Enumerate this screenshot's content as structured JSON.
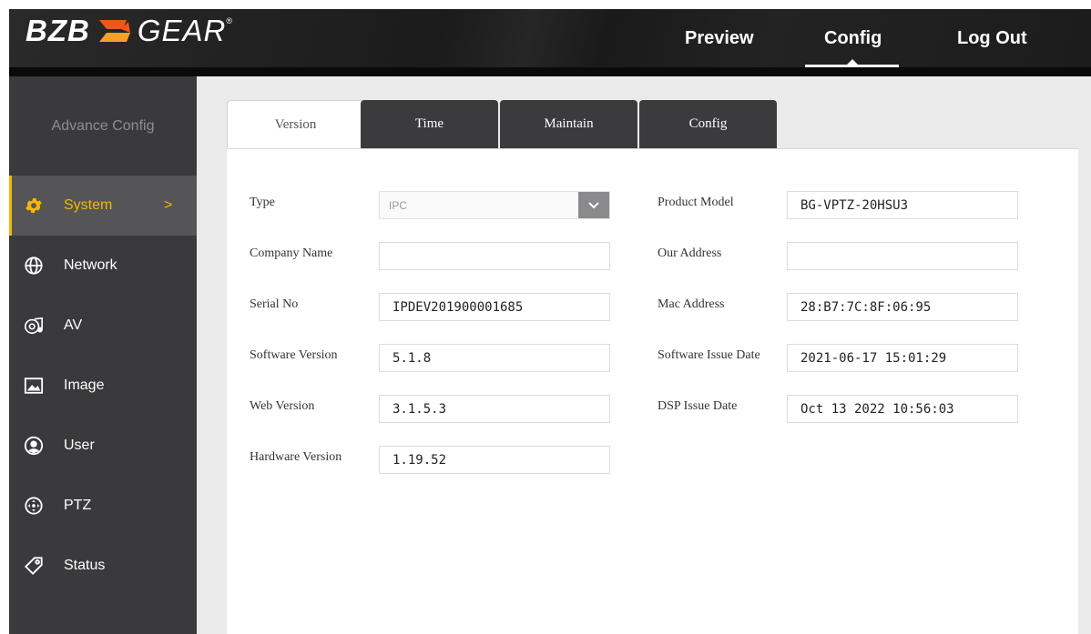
{
  "header": {
    "logo": {
      "left": "BZB",
      "right": "GEAR",
      "reg": "®",
      "mark_color_1": "#e8591a",
      "mark_color_2": "#f3a12a"
    },
    "nav": {
      "preview": "Preview",
      "config": "Config",
      "logout": "Log Out"
    },
    "active_nav": "Config"
  },
  "sidebar": {
    "title": "Advance Config",
    "accent": "#f5b800",
    "items": [
      {
        "label": "System",
        "icon": "gear-icon",
        "active": true,
        "chevron": ">"
      },
      {
        "label": "Network",
        "icon": "globe-icon"
      },
      {
        "label": "AV",
        "icon": "av-icon"
      },
      {
        "label": "Image",
        "icon": "image-icon"
      },
      {
        "label": "User",
        "icon": "user-icon"
      },
      {
        "label": "PTZ",
        "icon": "ptz-icon"
      },
      {
        "label": "Status",
        "icon": "tag-icon"
      }
    ]
  },
  "tabs": [
    {
      "label": "Version",
      "active": true
    },
    {
      "label": "Time"
    },
    {
      "label": "Maintain"
    },
    {
      "label": "Config"
    }
  ],
  "form": {
    "type": {
      "label": "Type",
      "value": "IPC"
    },
    "company_name": {
      "label": "Company Name",
      "value": ""
    },
    "serial_no": {
      "label": "Serial No",
      "value": "IPDEV201900001685"
    },
    "software_version": {
      "label": "Software Version",
      "value": "5.1.8"
    },
    "web_version": {
      "label": "Web Version",
      "value": "3.1.5.3"
    },
    "hardware_version": {
      "label": "Hardware Version",
      "value": "1.19.52"
    },
    "product_model": {
      "label": "Product Model",
      "value": "BG-VPTZ-20HSU3"
    },
    "our_address": {
      "label": "Our Address",
      "value": ""
    },
    "mac_address": {
      "label": "Mac Address",
      "value": "28:B7:7C:8F:06:95"
    },
    "software_issue_date": {
      "label": "Software Issue Date",
      "value": "2021-06-17 15:01:29"
    },
    "dsp_issue_date": {
      "label": "DSP Issue Date",
      "value": "Oct 13 2022 10:56:03"
    }
  }
}
